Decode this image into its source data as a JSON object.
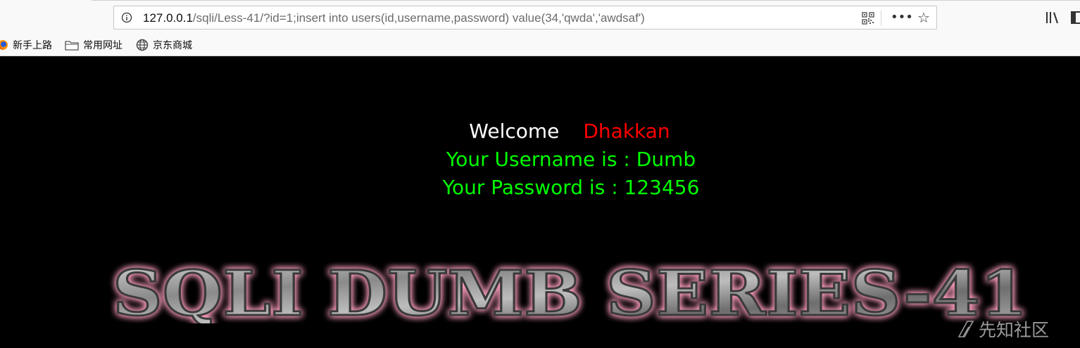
{
  "browser": {
    "url_host": "127.0.0.1",
    "url_path": "/sqli/Less-41/?id=1;insert into users(id,username,password) value(34,'qwda','awdsaf')",
    "bookmarks": [
      {
        "label": "新手上路",
        "icon": "firefox-icon"
      },
      {
        "label": "常用网址",
        "icon": "folder-icon"
      },
      {
        "label": "京东商城",
        "icon": "globe-icon"
      }
    ]
  },
  "page": {
    "welcome_label": "Welcome",
    "welcome_name": "Dhakkan",
    "username_line": "Your Username is : Dumb",
    "password_line": "Your Password is : 123456",
    "banner_text": "SQLI DUMB SERIES-41",
    "watermark_text": "先知社区"
  },
  "colors": {
    "welcome": "#ffffff",
    "name": "#ff0000",
    "info": "#00ff00",
    "background": "#000000"
  }
}
